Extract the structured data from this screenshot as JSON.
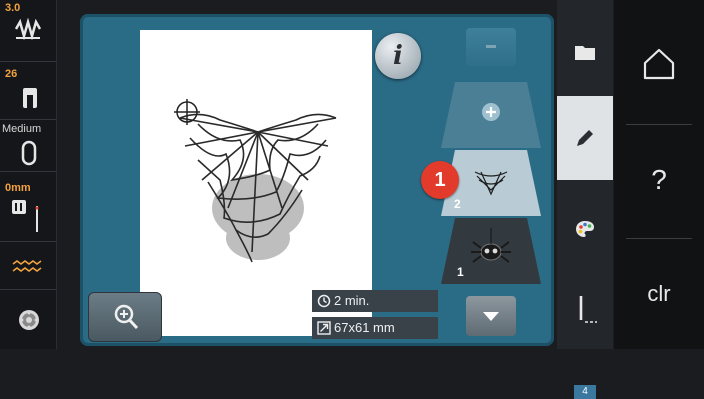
{
  "status_column": {
    "stitch_width_value": "3.0",
    "stitch_length_value": "26",
    "thread_tension_label": "Medium",
    "stitch_offset_value": "0mm"
  },
  "info_button": {
    "label": "i"
  },
  "embroidery_info": {
    "time": "2 min.",
    "size": "67x61 mm"
  },
  "layers": {
    "callout_number": "1",
    "items": [
      {
        "number": "2",
        "motif": "spider-web"
      },
      {
        "number": "1",
        "motif": "spider"
      }
    ]
  },
  "mode_tabs": {
    "color_count": "4"
  },
  "right_column": {
    "help_label": "?",
    "clear_label": "clr"
  },
  "colors": {
    "frame_blue": "#2a6b86",
    "layer_blue": "#4a7f96",
    "layer_selected": "#b9cbd4",
    "callout_red": "#e23a2b",
    "status_orange": "#f2a340"
  }
}
